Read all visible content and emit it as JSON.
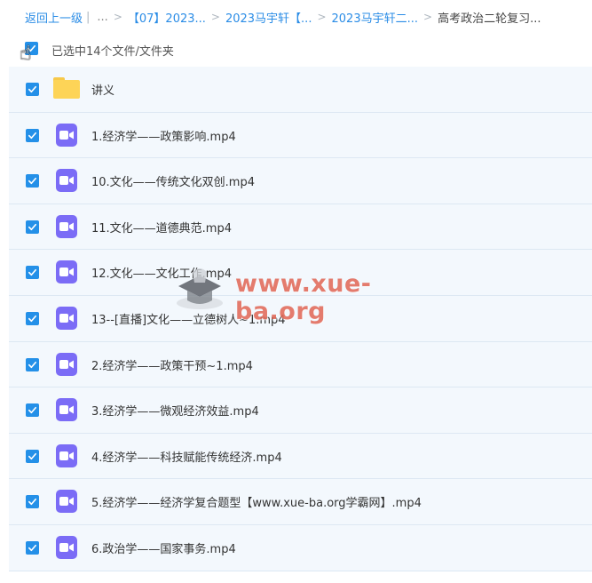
{
  "breadcrumb": {
    "back": "返回上一级",
    "divider": "|",
    "ellipsis": "...",
    "items": [
      "【07】2023...",
      "2023马宇轩【...",
      "2023马宇轩二...",
      "高考政治二轮复习..."
    ],
    "separator": ">"
  },
  "selection": {
    "label": "已选中14个文件/文件夹",
    "checked": true
  },
  "files": [
    {
      "name": "讲义",
      "type": "folder",
      "icon": "folder-icon"
    },
    {
      "name": "1.经济学——政策影响.mp4",
      "type": "video",
      "icon": "video-file-icon"
    },
    {
      "name": "10.文化——传统文化双创.mp4",
      "type": "video",
      "icon": "video-file-icon"
    },
    {
      "name": "11.文化——道德典范.mp4",
      "type": "video",
      "icon": "video-file-icon"
    },
    {
      "name": "12.文化——文化工作.mp4",
      "type": "video",
      "icon": "video-file-icon"
    },
    {
      "name": "13--[直播]文化——立德树人~1.mp4",
      "type": "video",
      "icon": "video-file-icon"
    },
    {
      "name": "2.经济学——政策干预~1.mp4",
      "type": "video",
      "icon": "video-file-icon"
    },
    {
      "name": "3.经济学——微观经济效益.mp4",
      "type": "video",
      "icon": "video-file-icon"
    },
    {
      "name": "4.经济学——科技赋能传统经济.mp4",
      "type": "video",
      "icon": "video-file-icon"
    },
    {
      "name": "5.经济学——经济学复合题型【www.xue-ba.org学霸网】.mp4",
      "type": "video",
      "icon": "video-file-icon"
    },
    {
      "name": "6.政治学——国家事务.mp4",
      "type": "video",
      "icon": "video-file-icon"
    }
  ],
  "watermark": {
    "text": "www.xue-ba.org",
    "icon": "graduation-cap-icon"
  },
  "colors": {
    "accent": "#2490e8",
    "link": "#2a8ce6",
    "video": "#7b6cf6",
    "folder": "#fdd457",
    "row_bg": "#f3f8fd"
  }
}
